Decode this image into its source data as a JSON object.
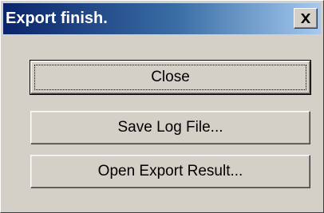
{
  "window": {
    "title": "Export finish."
  },
  "titlebar": {
    "close_glyph": "✕",
    "close_icon": "close-icon"
  },
  "buttons": {
    "close_label": "Close",
    "save_log_label": "Save Log File...",
    "open_result_label": "Open Export Result..."
  },
  "colors": {
    "titlebar_start": "#0a246a",
    "titlebar_end": "#a6caf0",
    "face": "#d4d0c8"
  }
}
